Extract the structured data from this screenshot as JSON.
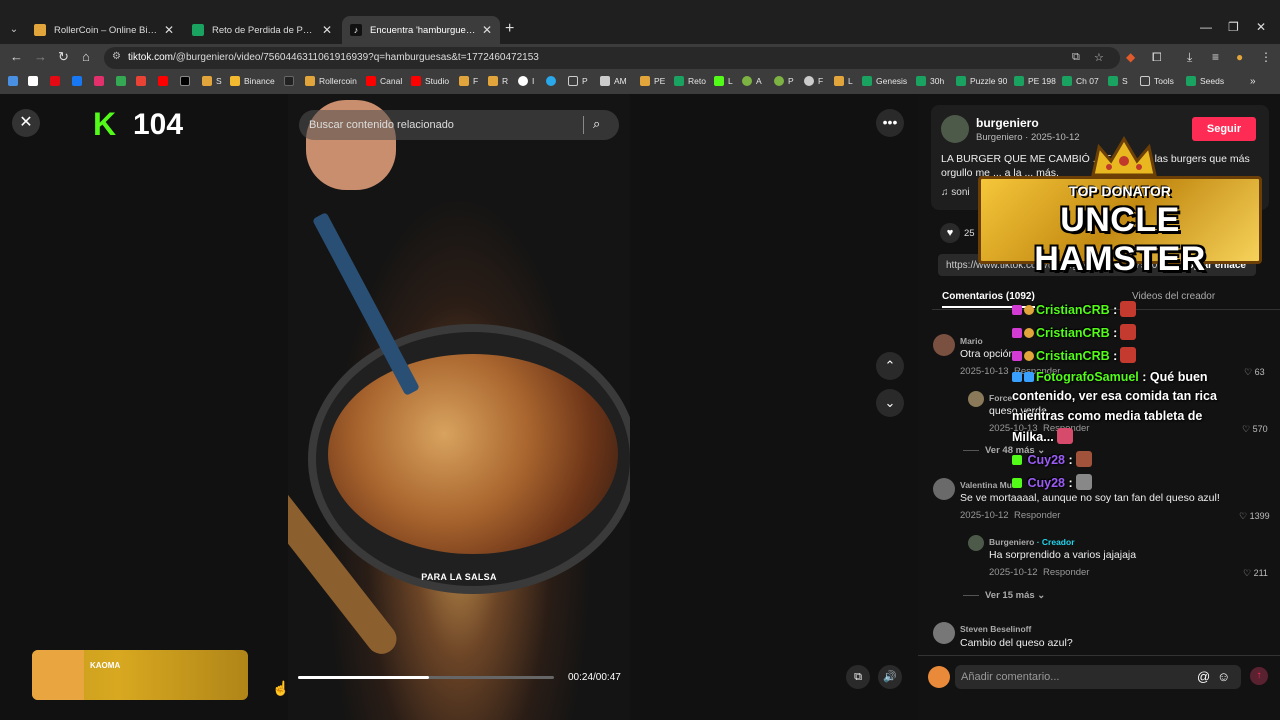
{
  "browser": {
    "tabs": [
      {
        "title": "RollerCoin – Online Bitcoin Mining",
        "active": false,
        "color": "#e2a53b"
      },
      {
        "title": "Reto de Perdida de Peso - El Ma",
        "active": false,
        "color": "#1aa260"
      },
      {
        "title": "Encuentra 'hamburguesas' ...",
        "active": true,
        "color": "#ffffff"
      }
    ],
    "url_host": "tiktok.com",
    "url_path": "/@burgeniero/video/7560446311061916939?q=hamburguesas&t=1772460472153",
    "bookmarks": [
      "S",
      "Binance",
      "Rollercoin",
      "Canal",
      "Studio",
      "F",
      "R",
      "I",
      "P",
      "AM",
      "PE",
      "Reto",
      "L",
      "A",
      "P",
      "F",
      "L",
      "Genesis",
      "30h",
      "Puzzle 90",
      "PE 198",
      "Ch 07",
      "S",
      "Tools",
      "Seeds"
    ]
  },
  "player": {
    "search_placeholder": "Buscar contenido relacionado",
    "caption": "PARA LA SALSA",
    "time": "00:24/00:47",
    "progress": 0.51,
    "music_artist": "KAOMA"
  },
  "stream_overlay": {
    "viewer_count": "104",
    "donator_label": "TOP DONATOR",
    "donator_name": "UNCLE HAMSTER",
    "chat": [
      {
        "user": "CristianCRB",
        "msg": ":"
      },
      {
        "user": "CristianCRB",
        "msg": ":"
      },
      {
        "user": "CristianCRB",
        "msg": ":"
      },
      {
        "user": "FotografoSamuel",
        "msg": ": Qué buen"
      },
      {
        "user": "",
        "msg": "contenido, ver esa comida tan rica"
      },
      {
        "user": "",
        "msg": "mientras como media tableta de"
      },
      {
        "user": "",
        "msg": "Milka..."
      },
      {
        "user": "Cuy28",
        "msg": ":"
      },
      {
        "user": "Cuy28",
        "msg": ":"
      }
    ]
  },
  "post": {
    "author": "burgeniero",
    "author_display": "Burgeniero",
    "date": "2025-10-12",
    "follow_label": "Seguir",
    "description": "LA BURGER QUE ME CAMBIÓ ... Es una de las burgers que más orgullo me ... a la ... más.",
    "sound_label": "soni",
    "likes": "25",
    "link_text": "https://www.tiktok.com/@burgeniero/video/7560...",
    "copy_label": "Copiar enlace"
  },
  "comments_tabs": {
    "comments": "Comentarios (1092)",
    "creator_videos": "Videos del creador"
  },
  "comments": [
    {
      "name": "Mario",
      "text": "Otra opción",
      "date": "2025-10-13",
      "reply": "Responder",
      "likes": "63"
    },
    {
      "name": "Force",
      "text": "queso verde",
      "date": "2025-10-13",
      "reply": "Responder",
      "likes": "570",
      "nested": true
    },
    {
      "more": "Ver 48 más"
    },
    {
      "name": "Valentina Mu",
      "text": "Se ve mortaaaal, aunque no soy tan fan del queso azul!",
      "date": "2025-10-12",
      "reply": "Responder",
      "likes": "1399"
    },
    {
      "name": "Burgeniero",
      "creator": "· Creador",
      "text": "Ha sorprendido a varios jajajaja",
      "date": "2025-10-12",
      "reply": "Responder",
      "likes": "211",
      "nested": true
    },
    {
      "more": "Ver 15 más"
    },
    {
      "name": "Steven Beselinoff",
      "text": "Cambio del queso azul?",
      "date": "",
      "reply": "",
      "likes": ""
    }
  ],
  "comment_box": {
    "placeholder": "Añadir comentario..."
  },
  "colors": {
    "accent": "#fe2c55",
    "kick_green": "#53fc18",
    "creator": "#20d5ec"
  }
}
